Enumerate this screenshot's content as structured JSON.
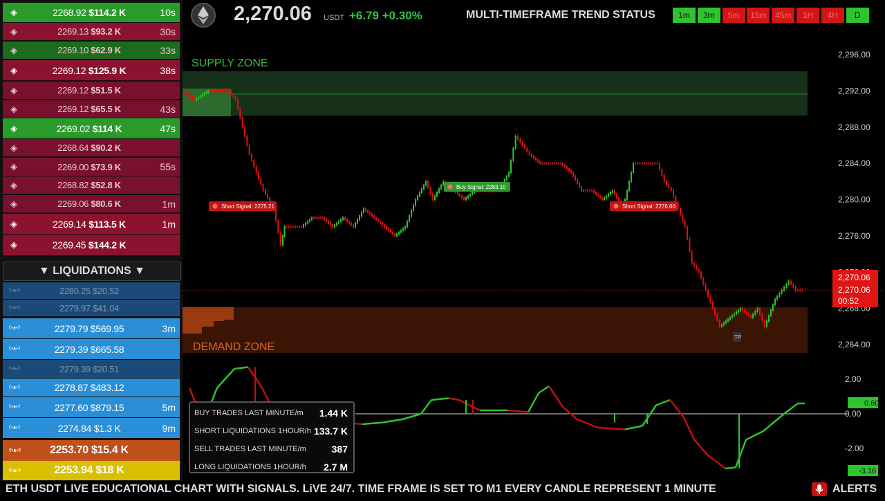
{
  "trades": [
    {
      "icon": "binance-icon",
      "price": "2268.92",
      "amount": "$114.2 K",
      "time": "10s",
      "bg": "#2a9a2a",
      "bold": true
    },
    {
      "icon": "binance-icon",
      "price": "2269.13",
      "amount": "$93.2 K",
      "time": "30s",
      "bg": "#8b1330",
      "bold": false
    },
    {
      "icon": "binance-icon",
      "price": "2269.10",
      "amount": "$62.9 K",
      "time": "33s",
      "bg": "#1d6b1d",
      "bold": false
    },
    {
      "icon": "binance-icon",
      "price": "2269.12",
      "amount": "$125.9 K",
      "time": "38s",
      "bg": "#8b1330",
      "bold": true
    },
    {
      "icon": "binance-icon",
      "price": "2269.12",
      "amount": "$51.5 K",
      "time": "",
      "bg": "#7a1030",
      "bold": false
    },
    {
      "icon": "binance-icon",
      "price": "2269.12",
      "amount": "$65.5 K",
      "time": "43s",
      "bg": "#7a1030",
      "bold": false
    },
    {
      "icon": "binance-icon",
      "price": "2269.02",
      "amount": "$114 K",
      "time": "47s",
      "bg": "#2a9a2a",
      "bold": true
    },
    {
      "icon": "binance-icon",
      "price": "2268.64",
      "amount": "$90.2 K",
      "time": "",
      "bg": "#7a1030",
      "bold": false
    },
    {
      "icon": "binance-icon",
      "price": "2269.00",
      "amount": "$73.9 K",
      "time": "55s",
      "bg": "#7a1030",
      "bold": false
    },
    {
      "icon": "binance-icon",
      "price": "2268.82",
      "amount": "$52.8 K",
      "time": "",
      "bg": "#7a1030",
      "bold": false
    },
    {
      "icon": "binance-icon",
      "price": "2269.06",
      "amount": "$80.6 K",
      "time": "1m",
      "bg": "#7a1030",
      "bold": false
    },
    {
      "icon": "binance-icon",
      "price": "2269.14",
      "amount": "$113.5 K",
      "time": "1m",
      "bg": "#8b1330",
      "bold": true
    },
    {
      "icon": "binance-icon",
      "price": "2269.45",
      "amount": "$144.2 K",
      "time": "",
      "bg": "#8b1330",
      "bold": true
    }
  ],
  "liquidations_header": "▼ LIQUIDATIONS ▼",
  "liquidations": [
    {
      "icon": "bear-icon",
      "price": "2280.25",
      "amount": "$20.52",
      "time": "",
      "bg": "#1c4a78",
      "dim": true
    },
    {
      "icon": "bear-icon",
      "price": "2279.97",
      "amount": "$41.04",
      "time": "",
      "bg": "#1c4a78",
      "dim": true
    },
    {
      "icon": "bear-icon",
      "price": "2279.79",
      "amount": "$569.95",
      "time": "3m",
      "bg": "#2b8fd8",
      "dim": false
    },
    {
      "icon": "bear-icon",
      "price": "2279.39",
      "amount": "$665.58",
      "time": "",
      "bg": "#2b8fd8",
      "dim": false
    },
    {
      "icon": "bear-icon",
      "price": "2279.39",
      "amount": "$20.51",
      "time": "",
      "bg": "#1c4a78",
      "dim": true
    },
    {
      "icon": "bear-icon",
      "price": "2278.87",
      "amount": "$483.12",
      "time": "",
      "bg": "#2b8fd8",
      "dim": false
    },
    {
      "icon": "bear-icon",
      "price": "2277.60",
      "amount": "$879.15",
      "time": "5m",
      "bg": "#2b8fd8",
      "dim": false
    },
    {
      "icon": "bear-icon",
      "price": "2274.84",
      "amount": "$1.3 K",
      "time": "9m",
      "bg": "#2b8fd8",
      "dim": false
    },
    {
      "icon": "bear-icon",
      "price": "2253.70",
      "amount": "$15.4 K",
      "time": "",
      "bg": "#c0501a",
      "dim": false
    },
    {
      "icon": "bear-icon",
      "price": "2253.94",
      "amount": "$18 K",
      "time": "",
      "bg": "#d8c000",
      "dim": false
    }
  ],
  "header": {
    "pair_icon": "ethereum-icon",
    "price": "2,270.06",
    "quote": "USDT",
    "change": "+6.79 +0.30%",
    "mtf_title": "MULTI-TIMEFRAME TREND STATUS"
  },
  "timeframes": [
    {
      "label": "1m",
      "color": "#2ec42e"
    },
    {
      "label": "3m",
      "color": "#2ec42e"
    },
    {
      "label": "5m",
      "color": "#d41515"
    },
    {
      "label": "15m",
      "color": "#d41515"
    },
    {
      "label": "45m",
      "color": "#d41515"
    },
    {
      "label": "1H",
      "color": "#d41515"
    },
    {
      "label": "4H",
      "color": "#d41515"
    },
    {
      "label": "D",
      "color": "#2ec42e"
    }
  ],
  "chart": {
    "supply_label": "SUPPLY ZONE",
    "demand_label": "DEMAND ZONE",
    "price_axis": [
      "2,296.00",
      "2,292.00",
      "2,288.00",
      "2,284.00",
      "2,280.00",
      "2,276.00",
      "2,272.00",
      "2,268.00",
      "2,264.00"
    ],
    "current_price": "2,270.06",
    "current_price2": "2,270.06",
    "countdown": "00:52",
    "signals": [
      {
        "label": "Short Signal: 2275.21",
        "type": "short"
      },
      {
        "label": "Buy Signal: 2283.10",
        "type": "buy"
      },
      {
        "label": "Short Signal: 2276.60",
        "type": "short"
      }
    ],
    "tp_label": "TP",
    "osc_axis": [
      "2.00",
      "0.00",
      "-2.00"
    ],
    "osc_value": "0.60",
    "osc_min": "-3.16"
  },
  "stats": [
    {
      "label": "BUY TRADES LAST MINUTE/m",
      "value": "1.44 K"
    },
    {
      "label": "SHORT LIQUIDATIONS 1HOUR/h",
      "value": "133.7 K"
    },
    {
      "label": "SELL TRADES LAST MINUTE/m",
      "value": "387"
    },
    {
      "label": "LONG LIQUIDATIONS 1HOUR/h",
      "value": "2.7 M"
    }
  ],
  "ticker": {
    "text": "ETH USDT  LIVE EDUCATIONAL CHART WITH SIGNALS. LiVE 24/7.   TIME FRAME IS SET TO M1  EVERY CANDLE REPRESENT 1 MINUTE",
    "alerts": "ALERTS",
    "alert_icon": "microphone-icon"
  }
}
